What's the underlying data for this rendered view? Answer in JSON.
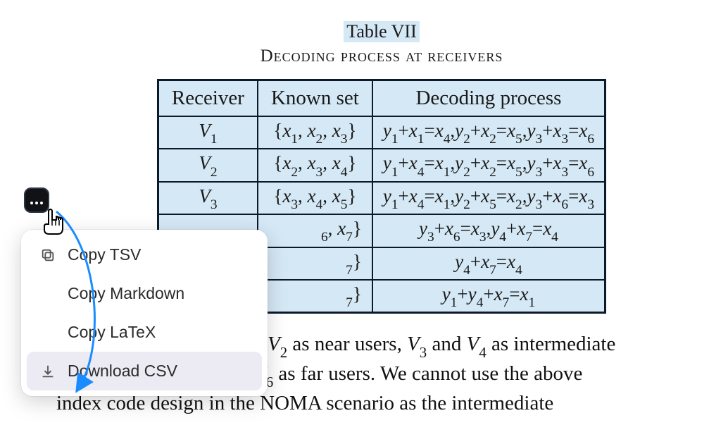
{
  "caption": {
    "number": "Table VII",
    "title": "Decoding process at receivers"
  },
  "headers": {
    "c0": "Receiver",
    "c1": "Known set",
    "c2": "Decoding process"
  },
  "rows": [
    {
      "receiver": "V₁",
      "known": "{x₁, x₂, x₃}",
      "decoding": "y₁+x₁=x₄, y₂+x₂=x₅, y₃+x₃=x₆"
    },
    {
      "receiver": "V₂",
      "known": "{x₂, x₃, x₄}",
      "decoding": "y₁+x₄=x₁, y₂+x₂=x₅, y₃+x₃=x₆"
    },
    {
      "receiver": "V₃",
      "known": "{x₃, x₄, x₅}",
      "decoding": "y₁+x₄=x₁, y₂+x₅=x₂, y₃+x₆=x₃"
    },
    {
      "receiver": "",
      "known": "…₆, x₇}",
      "decoding": "y₃+x₆=x₃, y₄+x₇=x₄"
    },
    {
      "receiver": "",
      "known": "…₇}",
      "decoding": "y₄+x₇=x₄"
    },
    {
      "receiver": "",
      "known": "…₇}",
      "decoding": "y₁+y₄+x₇=x₁"
    }
  ],
  "body_text": {
    "line1_a": "V₂",
    "line1_b": " as near users, ",
    "line1_c": "V₃",
    "line1_d": " and ",
    "line1_e": "V₄",
    "line1_f": " as intermediate",
    "line2_a": "V₆",
    "line2_b": " as far users. We cannot use the above",
    "line3": "index code design in the NOMA scenario as the intermediate"
  },
  "menu": {
    "items": [
      {
        "label": "Copy TSV",
        "icon": "copy-icon"
      },
      {
        "label": "Copy Markdown",
        "icon": ""
      },
      {
        "label": "Copy LaTeX",
        "icon": ""
      },
      {
        "label": "Download CSV",
        "icon": "download-icon"
      }
    ]
  },
  "chart_data": {
    "type": "table",
    "title": "Decoding process at receivers",
    "columns": [
      "Receiver",
      "Known set",
      "Decoding process"
    ],
    "rows": [
      [
        "V1",
        "{x1, x2, x3}",
        "y1+x1=x4, y2+x2=x5, y3+x3=x6"
      ],
      [
        "V2",
        "{x2, x3, x4}",
        "y1+x4=x1, y2+x2=x5, y3+x3=x6"
      ],
      [
        "V3",
        "{x3, x4, x5}",
        "y1+x4=x1, y2+x5=x2, y3+x6=x3"
      ],
      [
        "",
        "..., x6, x7}",
        "y3+x6=x3, y4+x7=x4"
      ],
      [
        "",
        "..., x7}",
        "y4+x7=x4"
      ],
      [
        "",
        "..., x7}",
        "y1+y4+x7=x1"
      ]
    ]
  }
}
